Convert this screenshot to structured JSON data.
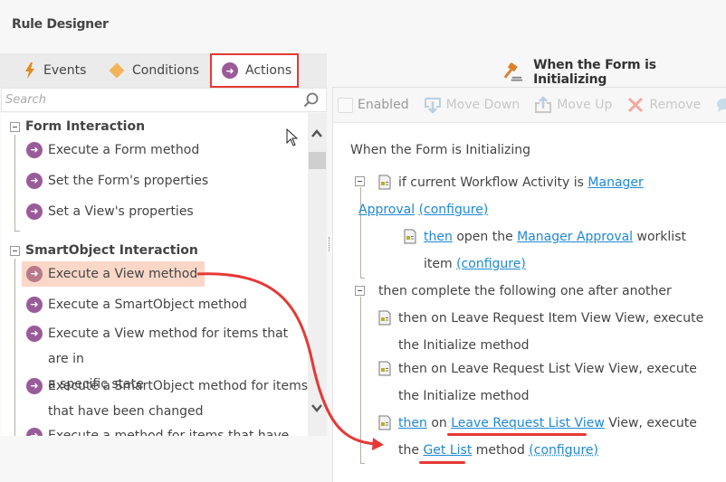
{
  "title": "Rule Designer",
  "tabs": [
    {
      "label": "Events",
      "icon": "lightning-bolt-icon"
    },
    {
      "label": "Conditions",
      "icon": "diamond-icon"
    },
    {
      "label": "Actions",
      "icon": "arrow-circle-icon",
      "selected": true
    }
  ],
  "search": {
    "placeholder": "Search",
    "value": ""
  },
  "tree": {
    "groups": [
      {
        "label": "Form Interaction",
        "items": [
          {
            "label": "Execute a Form method"
          },
          {
            "label": "Set the Form's properties"
          },
          {
            "label": "Set a View's properties"
          }
        ]
      },
      {
        "label": "SmartObject Interaction",
        "items": [
          {
            "label": "Execute a View method",
            "selected": true
          },
          {
            "label": "Execute a SmartObject method"
          },
          {
            "label_line1": "Execute a View method for items that are in",
            "label_line2": "a specific state"
          },
          {
            "label_line1": "Execute a SmartObject method for items",
            "label_line2": "that have been changed"
          },
          {
            "label": "Execute a method for items that have been"
          }
        ]
      }
    ]
  },
  "rule": {
    "header": "When the Form is Initializing",
    "toolbar": {
      "enabled_label": "Enabled",
      "enabled_checked": false,
      "move_down": "Move Down",
      "move_up": "Move Up",
      "remove": "Remove",
      "comment": "C"
    },
    "event_text": "When the Form is Initializing",
    "condition": {
      "prefix": "if current Workflow Activity is",
      "link_line1": "Manager",
      "link_line2": "Approval",
      "configure": "(configure)"
    },
    "condition_action": {
      "then": "then",
      "middle": "open the",
      "link": "Manager Approval",
      "suffix": "worklist",
      "line2": "item",
      "configure": "(configure)"
    },
    "sequence_label": "then complete the following one after another",
    "actions": [
      {
        "line1": "then on Leave Request Item View View, execute",
        "line2": "the Initialize method"
      },
      {
        "line1": "then on Leave Request List View View, execute",
        "line2": "the Initialize method"
      }
    ],
    "last_action": {
      "then": "then",
      "on": "on",
      "view_link": "Leave Request List View",
      "after_view": "View, execute",
      "the": "the",
      "method_link": "Get List",
      "method_word": "method",
      "configure": "(configure)"
    }
  },
  "colors": {
    "accent_link": "#1e88d6",
    "annotation_red": "#e53935",
    "action_purple": "#9a5b9a",
    "selected_bg": "#fbd7c8"
  }
}
